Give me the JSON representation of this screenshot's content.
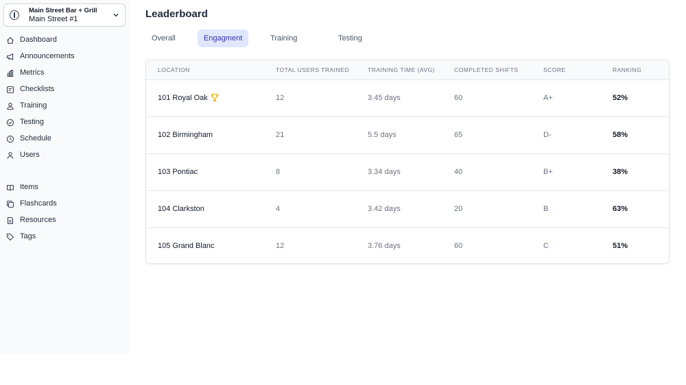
{
  "sidebar": {
    "org": {
      "name": "Main Street Bar + Grill",
      "location": "Main Street #1"
    },
    "items": [
      {
        "id": "dashboard",
        "label": "Dashboard",
        "icon": "home-icon"
      },
      {
        "id": "announcements",
        "label": "Announcements",
        "icon": "megaphone-icon"
      },
      {
        "id": "metrics",
        "label": "Metrics",
        "icon": "bar-chart-icon"
      },
      {
        "id": "checklists",
        "label": "Checklists",
        "icon": "checklist-icon"
      },
      {
        "id": "training",
        "label": "Training",
        "icon": "users-icon"
      },
      {
        "id": "testing",
        "label": "Testing",
        "icon": "check-circle-icon"
      },
      {
        "id": "schedule",
        "label": "Schedule",
        "icon": "clock-icon"
      },
      {
        "id": "users",
        "label": "Users",
        "icon": "user-icon"
      },
      {
        "id": "items",
        "label": "Items",
        "icon": "book-icon"
      },
      {
        "id": "flashcards",
        "label": "Flashcards",
        "icon": "copy-icon"
      },
      {
        "id": "resources",
        "label": "Resources",
        "icon": "document-icon"
      },
      {
        "id": "tags",
        "label": "Tags",
        "icon": "tag-icon"
      }
    ]
  },
  "main": {
    "title": "Leaderboard",
    "tabs": [
      {
        "label": "Overall",
        "active": false
      },
      {
        "label": "Engagment",
        "active": true
      },
      {
        "label": "Training",
        "active": false
      },
      {
        "label": "Testing",
        "active": false
      }
    ],
    "table": {
      "headers": [
        "LOCATION",
        "TOTAL USERS TRAINED",
        "TRAINING TIME (AVG)",
        "COMPLETED SHIFTS",
        "SCORE",
        "RANKING"
      ],
      "rows": [
        {
          "location": "101 Royal Oak",
          "users": "12",
          "time": "3.45 days",
          "shifts": "60",
          "score": "A+",
          "ranking": "52%",
          "trophy": true
        },
        {
          "location": "102 Birmingham",
          "users": "21",
          "time": "5.5 days",
          "shifts": "65",
          "score": "D-",
          "ranking": "58%",
          "trophy": false
        },
        {
          "location": "103 Pontiac",
          "users": "8",
          "time": "3.34 days",
          "shifts": "40",
          "score": "B+",
          "ranking": "38%",
          "trophy": false
        },
        {
          "location": "104 Clarkston",
          "users": "4",
          "time": "3.42 days",
          "shifts": "20",
          "score": "B",
          "ranking": "63%",
          "trophy": false
        },
        {
          "location": "105 Grand Blanc",
          "users": "12",
          "time": "3.76 days",
          "shifts": "60",
          "score": "C",
          "ranking": "51%",
          "trophy": false
        }
      ]
    }
  },
  "colors": {
    "accent_bg": "#e0e7ff",
    "accent_text": "#3730a3",
    "trophy": "#eab308"
  }
}
